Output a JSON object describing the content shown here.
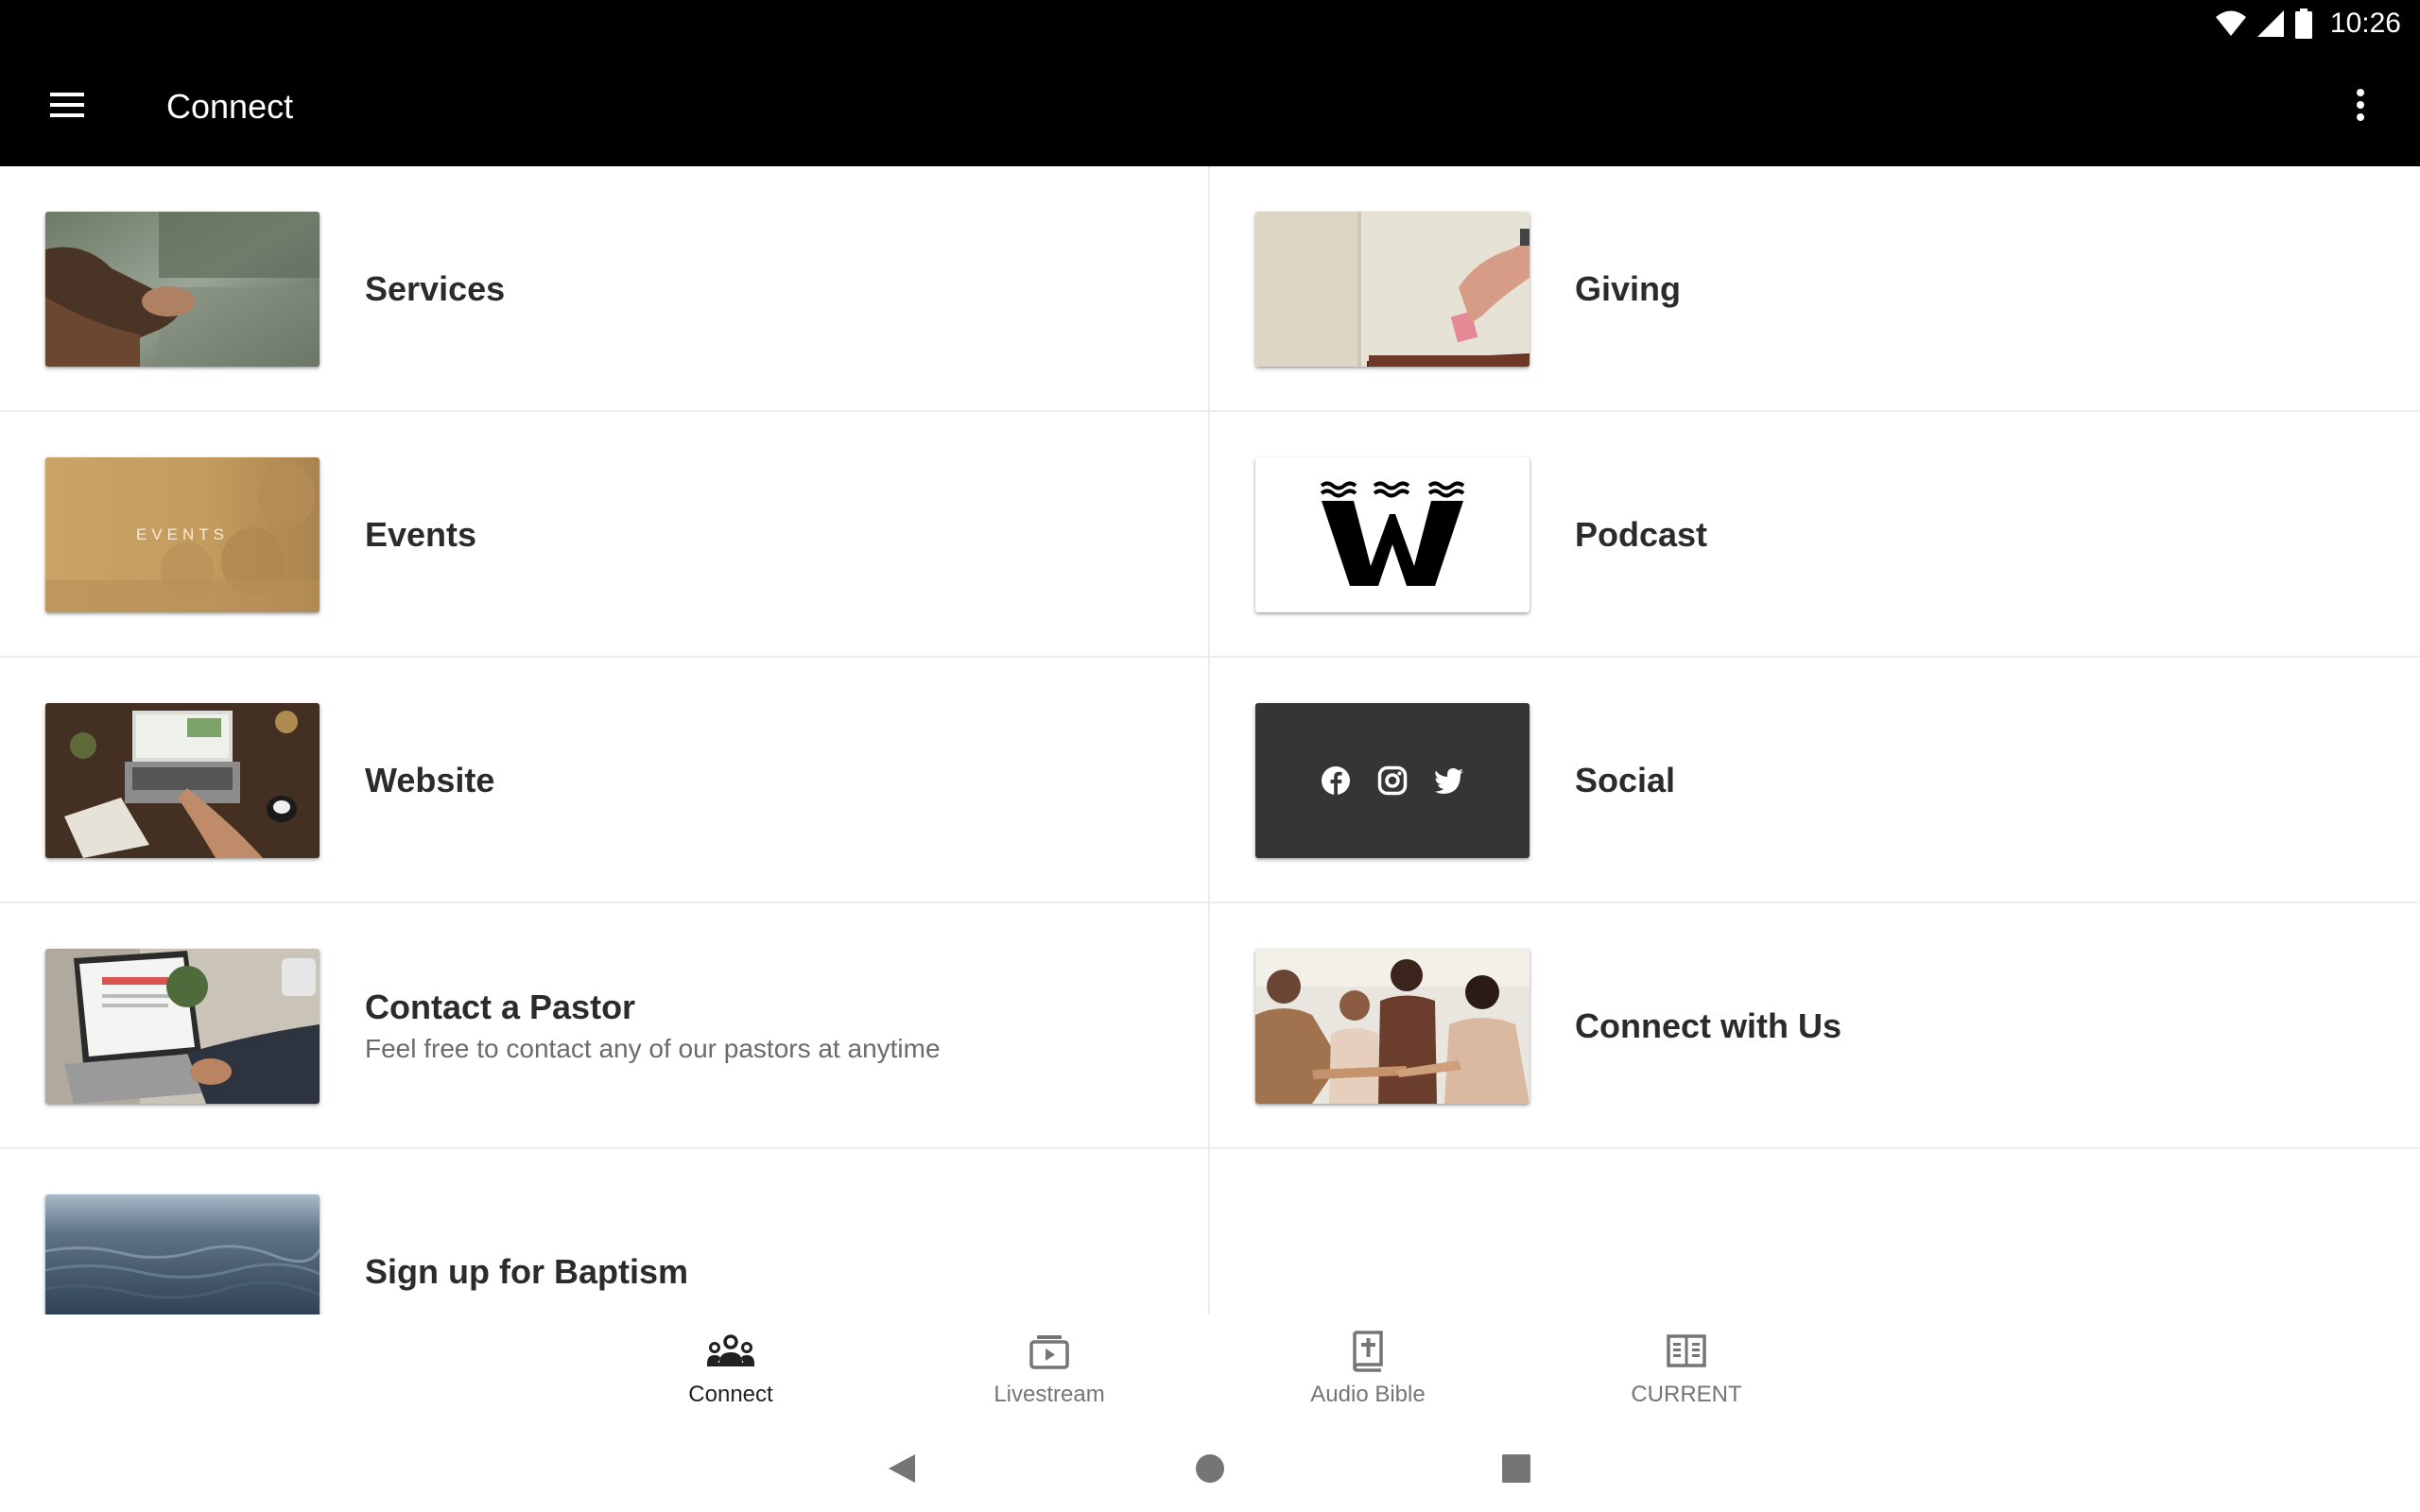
{
  "status_bar": {
    "time": "10:26",
    "icons": [
      "wifi-icon",
      "cellular-signal-icon",
      "battery-icon"
    ]
  },
  "app_bar": {
    "title": "Connect",
    "menu_icon": "hamburger-menu-icon",
    "overflow_icon": "more-vertical-icon"
  },
  "items": {
    "left": [
      {
        "title": "Services",
        "subtitle": ""
      },
      {
        "title": "Events",
        "subtitle": "",
        "thumb_text": "EVENTS"
      },
      {
        "title": "Website",
        "subtitle": ""
      },
      {
        "title": "Contact a Pastor",
        "subtitle": "Feel free to contact any of our pastors at anytime"
      },
      {
        "title": "Sign up for Baptism",
        "subtitle": ""
      }
    ],
    "right": [
      {
        "title": "Giving",
        "subtitle": ""
      },
      {
        "title": "Podcast",
        "subtitle": ""
      },
      {
        "title": "Social",
        "subtitle": ""
      },
      {
        "title": "Connect with Us",
        "subtitle": ""
      }
    ]
  },
  "bottom_nav": {
    "tabs": [
      {
        "label": "Connect",
        "icon": "people-group-icon",
        "active": true
      },
      {
        "label": "Livestream",
        "icon": "live-video-icon",
        "active": false
      },
      {
        "label": "Audio Bible",
        "icon": "bible-book-icon",
        "active": false
      },
      {
        "label": "CURRENT",
        "icon": "open-book-icon",
        "active": false
      }
    ]
  },
  "system_nav": [
    "back-icon",
    "home-icon",
    "recents-icon"
  ],
  "colors": {
    "app_bar_bg": "#000000",
    "divider": "#ececec",
    "social_tile_bg": "#353535",
    "events_tile_bg": "#c9a466",
    "active_tab": "#212121",
    "inactive_tab": "#757575"
  }
}
